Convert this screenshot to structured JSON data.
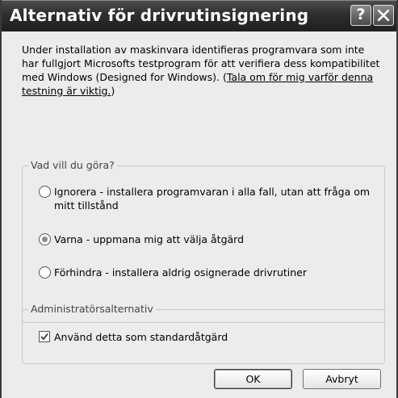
{
  "window": {
    "title": "Alternativ för drivrutinsignering",
    "help_glyph": "?"
  },
  "description": {
    "text": "Under installation av maskinvara identifieras programvara som inte har fullgjort Microsofts testprogram för att verifiera dess kompatibilitet med Windows (Designed for Windows). (",
    "link": "Tala om för mig varför denna testning är viktig.",
    "suffix": ")"
  },
  "action_group": {
    "legend": "Vad vill du göra?",
    "options": [
      {
        "label": "Ignorera - installera programvaran i alla fall, utan att fråga om mitt tillstånd",
        "selected": false
      },
      {
        "label": "Varna - uppmana mig att välja åtgärd",
        "selected": true
      },
      {
        "label": "Förhindra - installera aldrig osignerade drivrutiner",
        "selected": false
      }
    ]
  },
  "admin_group": {
    "legend": "Administratörsalternativ",
    "checkbox_label": "Använd detta som standardåtgärd",
    "checked": true
  },
  "buttons": {
    "ok": "OK",
    "cancel": "Avbryt"
  }
}
